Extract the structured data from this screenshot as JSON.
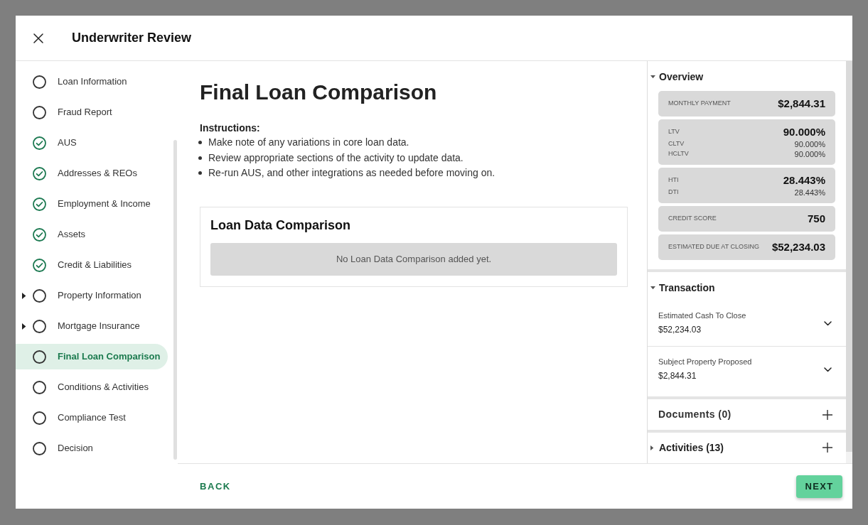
{
  "dialog": {
    "title": "Underwriter Review"
  },
  "steps": [
    {
      "label": "Loan Information",
      "completed": false,
      "expandable": false,
      "selected": false
    },
    {
      "label": "Fraud Report",
      "completed": false,
      "expandable": false,
      "selected": false
    },
    {
      "label": "AUS",
      "completed": true,
      "expandable": false,
      "selected": false
    },
    {
      "label": "Addresses & REOs",
      "completed": true,
      "expandable": false,
      "selected": false
    },
    {
      "label": "Employment & Income",
      "completed": true,
      "expandable": false,
      "selected": false
    },
    {
      "label": "Assets",
      "completed": true,
      "expandable": false,
      "selected": false
    },
    {
      "label": "Credit & Liabilities",
      "completed": true,
      "expandable": false,
      "selected": false
    },
    {
      "label": "Property Information",
      "completed": false,
      "expandable": true,
      "selected": false
    },
    {
      "label": "Mortgage Insurance",
      "completed": false,
      "expandable": true,
      "selected": false
    },
    {
      "label": "Final Loan Comparison",
      "completed": false,
      "expandable": false,
      "selected": true
    },
    {
      "label": "Conditions & Activities",
      "completed": false,
      "expandable": false,
      "selected": false
    },
    {
      "label": "Compliance Test",
      "completed": false,
      "expandable": false,
      "selected": false
    },
    {
      "label": "Decision",
      "completed": false,
      "expandable": false,
      "selected": false
    }
  ],
  "content": {
    "title": "Final Loan Comparison",
    "instructions_label": "Instructions:",
    "instructions": [
      "Make note of any variations in core loan data.",
      "Review appropriate sections of the activity to update data.",
      "Re-run AUS, and other integrations as needed before moving on."
    ],
    "card": {
      "title": "Loan Data Comparison",
      "empty_message": "No Loan Data Comparison added yet."
    }
  },
  "overview": {
    "title": "Overview",
    "expanded": true,
    "cards": [
      {
        "rows": [
          {
            "kind": "main",
            "label": "MONTHLY PAYMENT",
            "value": "$2,844.31"
          }
        ]
      },
      {
        "rows": [
          {
            "kind": "main",
            "label": "LTV",
            "value": "90.000%"
          },
          {
            "kind": "sub",
            "label": "CLTV",
            "value": "90.000%"
          },
          {
            "kind": "sub",
            "label": "HCLTV",
            "value": "90.000%"
          }
        ]
      },
      {
        "rows": [
          {
            "kind": "main",
            "label": "HTI",
            "value": "28.443%"
          },
          {
            "kind": "sub",
            "label": "DTI",
            "value": "28.443%"
          }
        ]
      },
      {
        "rows": [
          {
            "kind": "main",
            "label": "CREDIT SCORE",
            "value": "750"
          }
        ]
      },
      {
        "rows": [
          {
            "kind": "main",
            "label": "ESTIMATED DUE AT CLOSING",
            "value": "$52,234.03"
          }
        ]
      }
    ]
  },
  "transaction": {
    "title": "Transaction",
    "expanded": true,
    "items": [
      {
        "label": "Estimated Cash To Close",
        "value": "$52,234.03",
        "expanded": false
      },
      {
        "label": "Subject Property Proposed",
        "value": "$2,844.31",
        "expanded": false
      }
    ]
  },
  "documents": {
    "title": "Documents (0)"
  },
  "activities": {
    "title": "Activities (13)",
    "expanded": false
  },
  "footer": {
    "back": "BACK",
    "next": "NEXT"
  }
}
